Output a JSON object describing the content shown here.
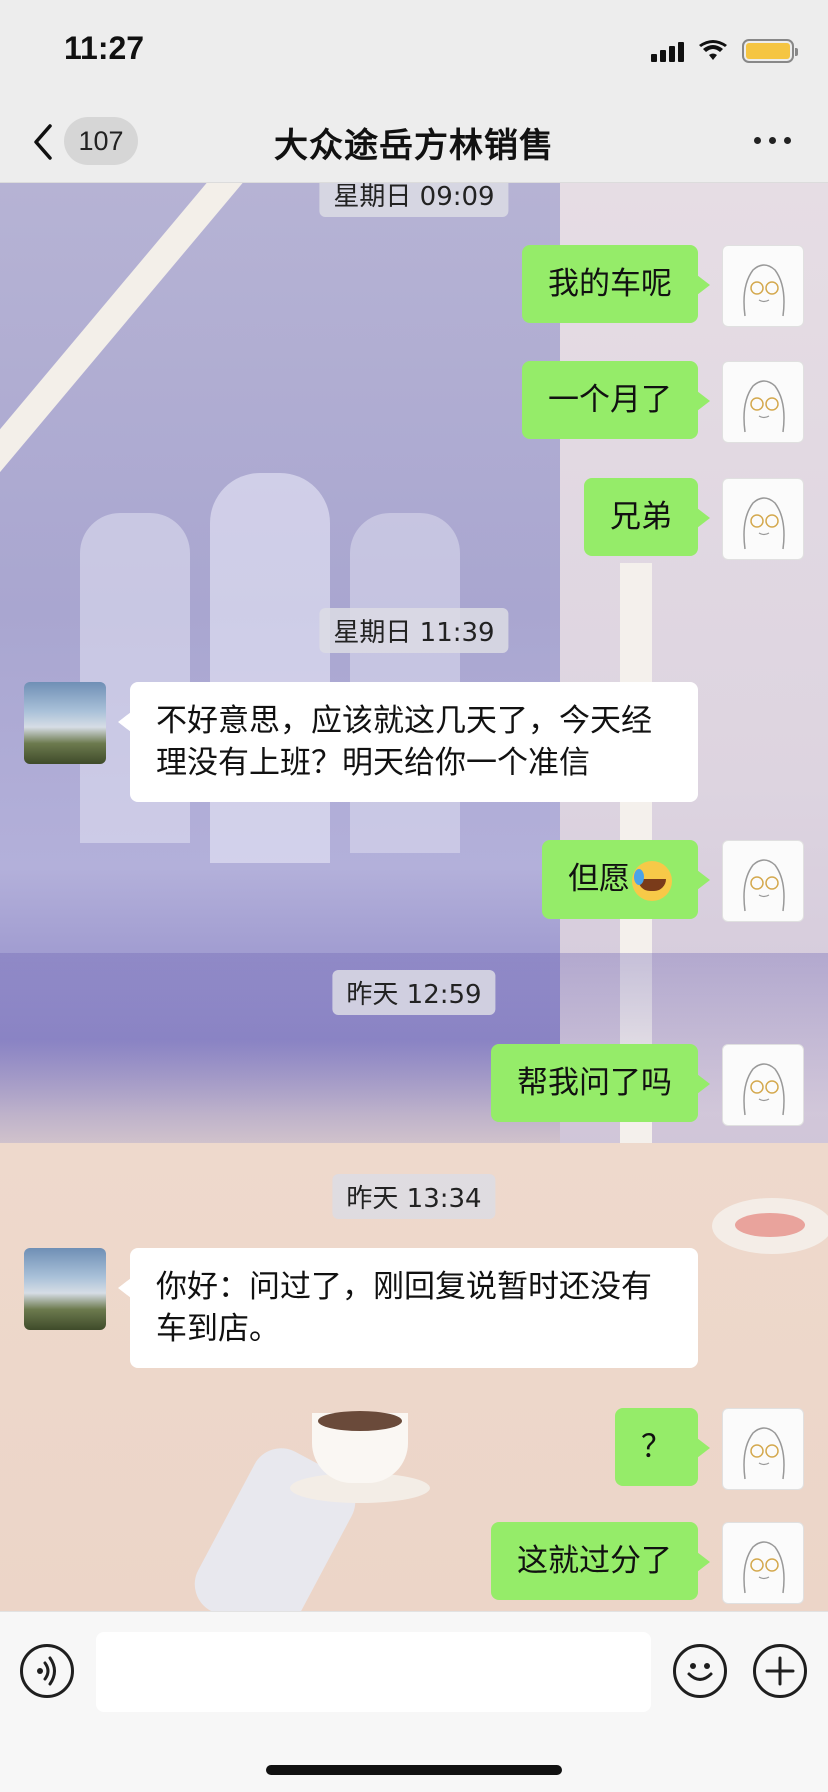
{
  "status_bar": {
    "time": "11:27"
  },
  "nav": {
    "unread_count": "107",
    "title": "大众途岳方林销售"
  },
  "messages": [
    {
      "type": "timestamp",
      "text": "星期日 09:09"
    },
    {
      "type": "me",
      "text": "我的车呢"
    },
    {
      "type": "me",
      "text": "一个月了"
    },
    {
      "type": "me",
      "text": "兄弟"
    },
    {
      "type": "timestamp",
      "text": "星期日 11:39"
    },
    {
      "type": "other",
      "text": "不好意思，应该就这几天了，今天经理没有上班？明天给你一个准信"
    },
    {
      "type": "me",
      "text": "但愿",
      "emoji": "rolling-on-floor-laughing-emoji"
    },
    {
      "type": "timestamp",
      "text": "昨天 12:59"
    },
    {
      "type": "me",
      "text": "帮我问了吗"
    },
    {
      "type": "timestamp",
      "text": "昨天 13:34"
    },
    {
      "type": "other",
      "text": "你好：问过了，刚回复说暂时还没有车到店。"
    },
    {
      "type": "me",
      "text": "？"
    },
    {
      "type": "me",
      "text": "这就过分了"
    }
  ],
  "input": {
    "value": ""
  },
  "colors": {
    "my_bubble": "#95ec69",
    "other_bubble": "#ffffff",
    "bar_bg": "#ededed"
  }
}
